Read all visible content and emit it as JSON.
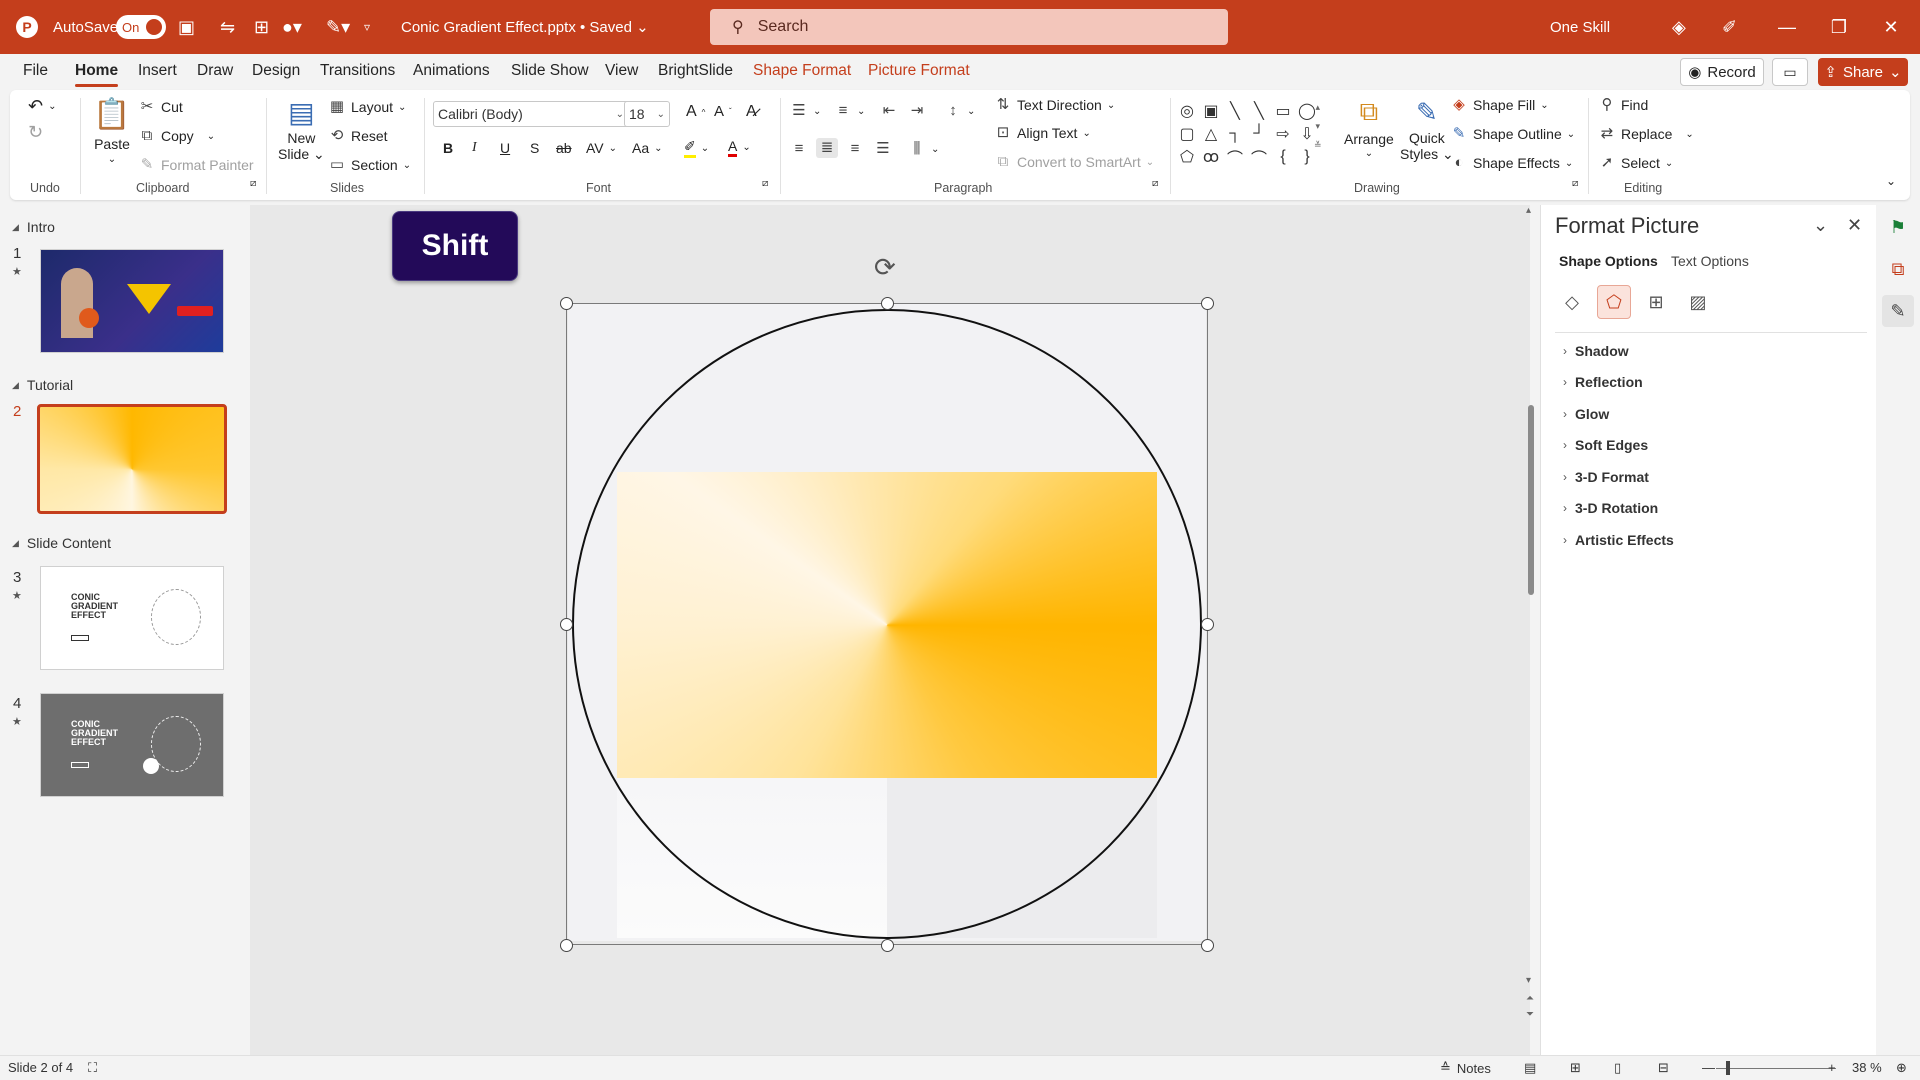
{
  "titlebar": {
    "autosave_label": "AutoSave",
    "autosave_state": "On",
    "document_title": "Conic Gradient Effect.pptx • Saved",
    "search_placeholder": "Search",
    "user_name": "One Skill",
    "accent_color": "#c43e1c"
  },
  "menu": {
    "tabs": [
      "File",
      "Home",
      "Insert",
      "Draw",
      "Design",
      "Transitions",
      "Animations",
      "Slide Show",
      "View",
      "BrightSlide",
      "Shape Format",
      "Picture Format"
    ],
    "active_tab": "Home",
    "record_label": "Record",
    "share_label": "Share"
  },
  "ribbon": {
    "undo_group": "Undo",
    "clipboard": {
      "label": "Clipboard",
      "paste": "Paste",
      "cut": "Cut",
      "copy": "Copy",
      "format_painter": "Format Painter"
    },
    "slides": {
      "label": "Slides",
      "new_slide_1": "New",
      "new_slide_2": "Slide",
      "layout": "Layout",
      "reset": "Reset",
      "section": "Section"
    },
    "font": {
      "label": "Font",
      "font_name": "Calibri (Body)",
      "font_size": "18"
    },
    "paragraph": {
      "label": "Paragraph",
      "text_direction": "Text Direction",
      "align_text": "Align Text",
      "convert_smartart": "Convert to SmartArt"
    },
    "drawing": {
      "label": "Drawing",
      "arrange": "Arrange",
      "quick_styles_1": "Quick",
      "quick_styles_2": "Styles",
      "shape_fill": "Shape Fill",
      "shape_outline": "Shape Outline",
      "shape_effects": "Shape Effects"
    },
    "editing": {
      "label": "Editing",
      "find": "Find",
      "replace": "Replace",
      "select": "Select"
    }
  },
  "thumbnails": {
    "sections": [
      "Intro",
      "Tutorial",
      "Slide Content"
    ],
    "slides": [
      {
        "number": "1",
        "section": "Intro"
      },
      {
        "number": "2",
        "section": "Tutorial"
      },
      {
        "number": "3",
        "section": "Slide Content",
        "text": "CONIC GRADIENT EFFECT"
      },
      {
        "number": "4",
        "section": "Slide Content",
        "text": "CONIC GRADIENT EFFECT"
      }
    ],
    "selected_slide": "2"
  },
  "canvas": {
    "key_badge": "Shift"
  },
  "format_pane": {
    "title": "Format Picture",
    "tabs": [
      "Shape Options",
      "Text Options"
    ],
    "active_tab": "Shape Options",
    "sections": [
      "Shadow",
      "Reflection",
      "Glow",
      "Soft Edges",
      "3-D Format",
      "3-D Rotation",
      "Artistic Effects"
    ]
  },
  "statusbar": {
    "slide_position": "Slide 2 of 4",
    "notes_label": "Notes",
    "zoom": "38 %"
  }
}
